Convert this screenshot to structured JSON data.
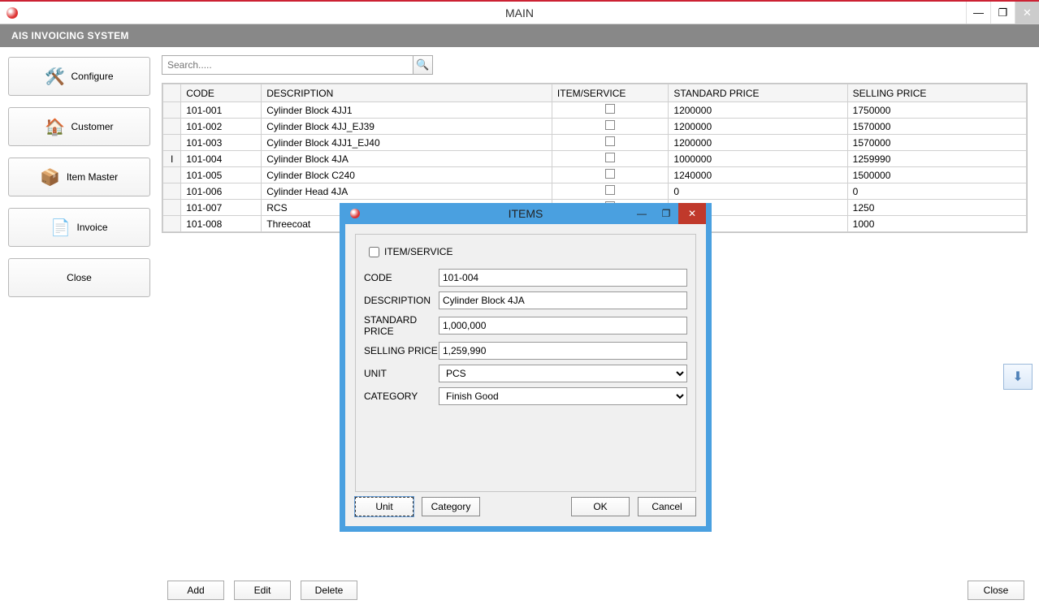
{
  "window": {
    "title": "MAIN",
    "min": "—",
    "max": "❐",
    "close": "✕"
  },
  "app_header": "AIS INVOICING SYSTEM",
  "sidebar": {
    "configure": "Configure",
    "customer": "Customer",
    "item_master": "Item Master",
    "invoice": "Invoice",
    "close": "Close"
  },
  "search": {
    "placeholder": "Search....."
  },
  "columns": {
    "code": "CODE",
    "description": "DESCRIPTION",
    "item_service": "ITEM/SERVICE",
    "standard_price": "STANDARD PRICE",
    "selling_price": "SELLING PRICE"
  },
  "rows": [
    {
      "marker": "",
      "code": "101-001",
      "description": "Cylinder Block 4JJ1",
      "std": "1200000",
      "sell": "1750000"
    },
    {
      "marker": "",
      "code": "101-002",
      "description": "Cylinder Block 4JJ_EJ39",
      "std": "1200000",
      "sell": "1570000"
    },
    {
      "marker": "",
      "code": "101-003",
      "description": "Cylinder Block 4JJ1_EJ40",
      "std": "1200000",
      "sell": "1570000"
    },
    {
      "marker": "I",
      "code": "101-004",
      "description": "Cylinder Block 4JA",
      "std": "1000000",
      "sell": "1259990"
    },
    {
      "marker": "",
      "code": "101-005",
      "description": "Cylinder Block C240",
      "std": "1240000",
      "sell": "1500000"
    },
    {
      "marker": "",
      "code": "101-006",
      "description": "Cylinder Head 4JA",
      "std": "0",
      "sell": "0"
    },
    {
      "marker": "",
      "code": "101-007",
      "description": "RCS",
      "std": "",
      "sell": "1250"
    },
    {
      "marker": "",
      "code": "101-008",
      "description": "Threecoat",
      "std": "",
      "sell": "1000"
    }
  ],
  "buttons": {
    "add": "Add",
    "edit": "Edit",
    "delete": "Delete",
    "close": "Close"
  },
  "dialog": {
    "title": "ITEMS",
    "min": "—",
    "max": "❐",
    "close": "✕",
    "item_service_label": "ITEM/SERVICE",
    "fields": {
      "code_label": "CODE",
      "code_value": "101-004",
      "description_label": "DESCRIPTION",
      "description_value": "Cylinder Block 4JA",
      "standard_price_label": "STANDARD PRICE",
      "standard_price_value": "1,000,000",
      "selling_price_label": "SELLING PRICE",
      "selling_price_value": "1,259,990",
      "unit_label": "UNIT",
      "unit_value": "PCS",
      "category_label": "CATEGORY",
      "category_value": "Finish Good"
    },
    "buttons": {
      "unit": "Unit",
      "category": "Category",
      "ok": "OK",
      "cancel": "Cancel"
    }
  }
}
